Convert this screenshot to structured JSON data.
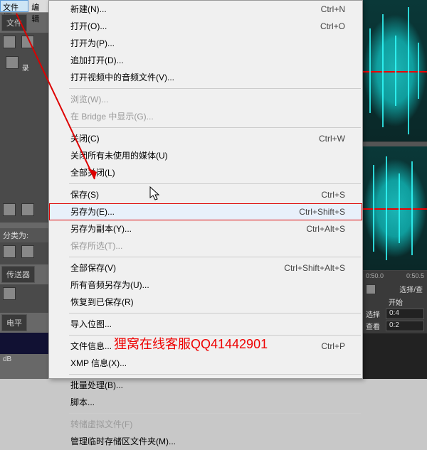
{
  "menubar": {
    "file": "文件(F)",
    "edit": "编辑"
  },
  "sidebar": {
    "files_tab": "文件",
    "record_row": "录",
    "category_label": "分类为:",
    "transport_tab": "传送器",
    "level_tab": "电平",
    "db_label": "dB"
  },
  "menu": {
    "items": [
      {
        "label": "新建(N)...",
        "shortcut": "Ctrl+N"
      },
      {
        "label": "打开(O)...",
        "shortcut": "Ctrl+O"
      },
      {
        "label": "打开为(P)..."
      },
      {
        "label": "追加打开(D)..."
      },
      {
        "label": "打开视频中的音频文件(V)..."
      },
      {
        "sep": true
      },
      {
        "label": "浏览(W)...",
        "disabled": true
      },
      {
        "label": "在 Bridge 中显示(G)...",
        "disabled": true
      },
      {
        "sep": true
      },
      {
        "label": "关闭(C)",
        "shortcut": "Ctrl+W"
      },
      {
        "label": "关闭所有未使用的媒体(U)"
      },
      {
        "label": "全部关闭(L)"
      },
      {
        "sep": true
      },
      {
        "label": "保存(S)",
        "shortcut": "Ctrl+S"
      },
      {
        "label": "另存为(E)...",
        "shortcut": "Ctrl+Shift+S",
        "highlighted": true,
        "hover": true
      },
      {
        "label": "另存为副本(Y)...",
        "shortcut": "Ctrl+Alt+S"
      },
      {
        "label": "保存所选(T)...",
        "disabled": true
      },
      {
        "sep": true
      },
      {
        "label": "全部保存(V)",
        "shortcut": "Ctrl+Shift+Alt+S"
      },
      {
        "label": "所有音频另存为(U)..."
      },
      {
        "label": "恢复到已保存(R)"
      },
      {
        "sep": true
      },
      {
        "label": "导入位图..."
      },
      {
        "sep": true
      },
      {
        "label": "文件信息...",
        "shortcut": "Ctrl+P"
      },
      {
        "label": "XMP 信息(X)..."
      },
      {
        "sep": true
      },
      {
        "label": "批量处理(B)..."
      },
      {
        "label": "脚本..."
      },
      {
        "sep": true
      },
      {
        "label": "转储虚拟文件(F)",
        "disabled": true
      },
      {
        "label": "管理临时存储区文件夹(M)..."
      }
    ]
  },
  "waveform": {
    "time_marks": [
      "0:50.0",
      "0:50.5"
    ],
    "select_tab": "选择/查",
    "start_label": "开始",
    "select_label": "选择",
    "select_value": "0:4",
    "view_label": "查看",
    "view_value": "0:2"
  },
  "watermark": "狸窝在线客服QQ41442901"
}
